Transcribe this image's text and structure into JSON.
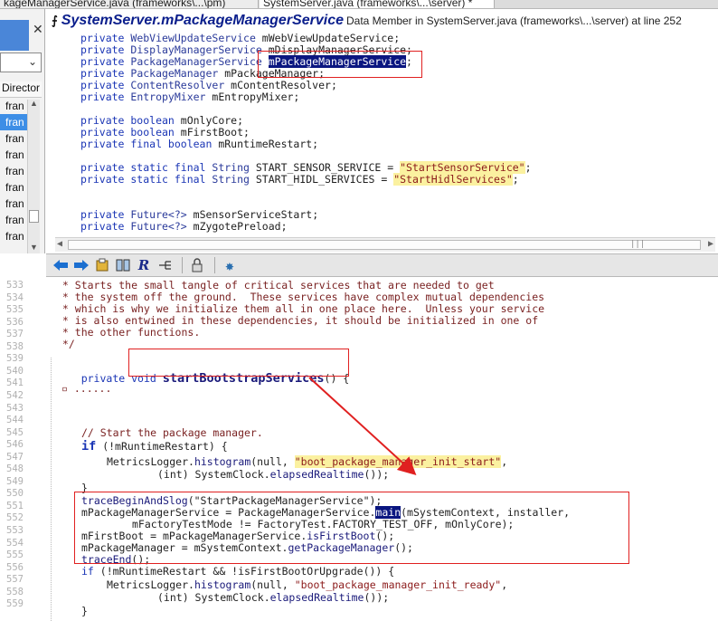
{
  "tabs": [
    {
      "label": "kageManagerService.java (frameworks\\...\\pm)",
      "active": false
    },
    {
      "label": "SystemServer.java (frameworks\\...\\server) *",
      "active": true
    }
  ],
  "left_panel": {
    "header": "Director",
    "items": [
      "fran",
      "fran",
      "fran",
      "fran",
      "fran",
      "fran",
      "fran",
      "fran",
      "fran"
    ]
  },
  "title_bar": {
    "icon": "function-icon",
    "symbol": "SystemServer.mPackageManagerService",
    "description": "Data Member in SystemServer.java (frameworks\\...\\server) at line 252"
  },
  "top_code": [
    [
      [
        "kw",
        "private "
      ],
      [
        "ty",
        "WebViewUpdateService "
      ],
      [
        "var",
        "mWebViewUpdateService;"
      ]
    ],
    [
      [
        "kw",
        "private "
      ],
      [
        "ty",
        "DisplayManagerService "
      ],
      [
        "var",
        "mDisplayManagerService;"
      ]
    ],
    [
      [
        "kw",
        "private "
      ],
      [
        "ty",
        "PackageManagerService "
      ],
      [
        "sel",
        "mPackageManagerService"
      ],
      [
        "var",
        ";"
      ]
    ],
    [
      [
        "kw",
        "private "
      ],
      [
        "ty",
        "PackageManager "
      ],
      [
        "var",
        "mPackageManager;"
      ]
    ],
    [
      [
        "kw",
        "private "
      ],
      [
        "ty",
        "ContentResolver "
      ],
      [
        "var",
        "mContentResolver;"
      ]
    ],
    [
      [
        "kw",
        "private "
      ],
      [
        "ty",
        "EntropyMixer "
      ],
      [
        "var",
        "mEntropyMixer;"
      ]
    ],
    [],
    [
      [
        "kw",
        "private boolean "
      ],
      [
        "var",
        "mOnlyCore;"
      ]
    ],
    [
      [
        "kw",
        "private boolean "
      ],
      [
        "var",
        "mFirstBoot;"
      ]
    ],
    [
      [
        "kw",
        "private final boolean "
      ],
      [
        "var",
        "mRuntimeRestart;"
      ]
    ],
    [],
    [
      [
        "kw",
        "private static final "
      ],
      [
        "ty",
        "String "
      ],
      [
        "var",
        "START_SENSOR_SERVICE = "
      ],
      [
        "strhl",
        "\"StartSensorService\""
      ],
      [
        "var",
        ";"
      ]
    ],
    [
      [
        "kw",
        "private static final "
      ],
      [
        "ty",
        "String "
      ],
      [
        "var",
        "START_HIDL_SERVICES = "
      ],
      [
        "strhl",
        "\"StartHidlServices\""
      ],
      [
        "var",
        ";"
      ]
    ],
    [],
    [],
    [
      [
        "kw",
        "private "
      ],
      [
        "ty",
        "Future<?> "
      ],
      [
        "var",
        "mSensorServiceStart;"
      ]
    ],
    [
      [
        "kw",
        "private "
      ],
      [
        "ty",
        "Future<?> "
      ],
      [
        "var",
        "mZygotePreload;"
      ]
    ]
  ],
  "line_numbers": [
    "533",
    "534",
    "535",
    "536",
    "537",
    "538",
    "539",
    "540",
    "541",
    "542",
    "543",
    "544",
    "545",
    "546",
    "547",
    "548",
    "549",
    "550",
    "551",
    "552",
    "553",
    "554",
    "555",
    "556",
    "557",
    "558",
    "559"
  ],
  "bottom_code": {
    "comment": [
      " * Starts the small tangle of critical services that are needed to get",
      " * the system off the ground.  These services have complex mutual dependencies",
      " * which is why we initialize them all in one place here.  Unless your service",
      " * is also entwined in these dependencies, it should be initialized in one of",
      " * the other functions.",
      " */"
    ],
    "method_prefix": "private void ",
    "method_name": "startBootstrapServices",
    "method_suffix": "() {",
    "ellipsis": "......",
    "start_comment": "// Start the package manager.",
    "if1_kw": "if",
    "if1_cond": " (!mRuntimeRestart) {",
    "metrics1_obj": "MetricsLogger.",
    "metrics1_call": "histogram",
    "metrics1_args": "(null, ",
    "metrics1_str": "\"boot_package_manager_init_start\"",
    "metrics1_end": ",",
    "metrics1_line2": "(int) SystemClock.",
    "metrics1_line2_call": "elapsedRealtime",
    "metrics1_line2_end": "());",
    "close1": "}",
    "trace_begin": "traceBeginAndSlog",
    "trace_begin_args": "(\"StartPackageManagerService\");",
    "pms_assign": "mPackageManagerService = PackageManagerService.",
    "pms_main": "main",
    "pms_args": "(mSystemContext, installer,",
    "pms_line2": "mFactoryTestMode != FactoryTest.FACTORY_TEST_OFF, mOnlyCore);",
    "first_boot_prefix": "mFirstBoot = mPackageManagerService.",
    "first_boot_call": "isFirstBoot",
    "first_boot_end": "();",
    "pm_prefix": "mPackageManager = mSystemContext.",
    "pm_call": "getPackageManager",
    "pm_end": "();",
    "trace_end": "traceEnd",
    "trace_end_args": "();",
    "if2_kw": "if",
    "if2_cond": " (!mRuntimeRestart && !isFirstBootOrUpgrade()) {",
    "metrics2_obj": "MetricsLogger.",
    "metrics2_call": "histogram",
    "metrics2_args": "(null, ",
    "metrics2_str": "\"boot_package_manager_init_ready\"",
    "metrics2_end": ",",
    "metrics2_line2": "(int) SystemClock.",
    "metrics2_line2_call": "elapsedRealtime",
    "metrics2_line2_end": "());",
    "close2": "}"
  },
  "colors": {
    "annotation": "#e02020",
    "selection": "#0a1680",
    "highlight": "#fbf1a0",
    "keyword": "#1a35b5"
  }
}
